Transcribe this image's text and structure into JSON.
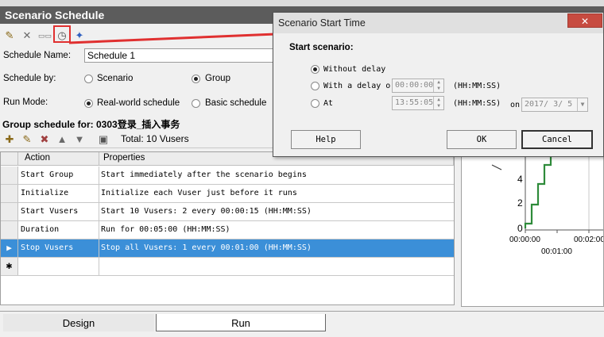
{
  "main": {
    "title": "Scenario Schedule",
    "schedule_name_label": "Schedule Name:",
    "schedule_name_value": "Schedule 1",
    "schedule_by_label": "Schedule by:",
    "schedule_by_options": [
      "Scenario",
      "Group"
    ],
    "schedule_by_selected": "Group",
    "run_mode_label": "Run Mode:",
    "run_mode_options": [
      "Real-world schedule",
      "Basic schedule"
    ],
    "run_mode_selected": "Real-world schedule",
    "group_header": "Group schedule for: 0303登录_插入事务",
    "total_label": "Total: 10 Vusers"
  },
  "grid": {
    "headers": [
      "Action",
      "Properties"
    ],
    "rows": [
      {
        "action": "Start Group",
        "properties": "Start immediately after the scenario begins"
      },
      {
        "action": "Initialize",
        "properties": "Initialize each Vuser just before it runs"
      },
      {
        "action": "Start  Vusers",
        "properties": "Start 10 Vusers: 2 every 00:00:15 (HH:MM:SS)"
      },
      {
        "action": "Duration",
        "properties": "Run for 00:05:00 (HH:MM:SS)"
      },
      {
        "action": "Stop Vusers",
        "properties": "Stop all Vusers: 1 every 00:01:00 (HH:MM:SS)"
      }
    ],
    "selected_row_marker": "▶",
    "new_row_marker": "✱"
  },
  "graph": {
    "y_ticks": [
      "4",
      "2",
      "0"
    ],
    "x_ticks": [
      "00:00:00",
      "00:01:00",
      "00:02:00"
    ],
    "line_color": "#2e8b3a"
  },
  "tabs": [
    "Design",
    "Run"
  ],
  "dialog": {
    "title": "Scenario Start Time",
    "close_glyph": "✕",
    "heading": "Start scenario:",
    "opt_without_delay": "Without delay",
    "opt_with_delay": "With a delay o",
    "delay_value": "00:00:00",
    "delay_unit": "(HH:MM:SS)",
    "opt_at": "At",
    "at_time_value": "13:55:05",
    "at_unit": "(HH:MM:SS)",
    "on_label": "on",
    "date_value": "2017/ 3/ 5",
    "selected_option": "Without delay",
    "help_button": "Help",
    "ok_button": "OK",
    "cancel_button": "Cancel"
  },
  "colors": {
    "accent_selection": "#3b8fd8",
    "annotation_red": "#e03030",
    "titlebar": "#5c5c5c"
  }
}
